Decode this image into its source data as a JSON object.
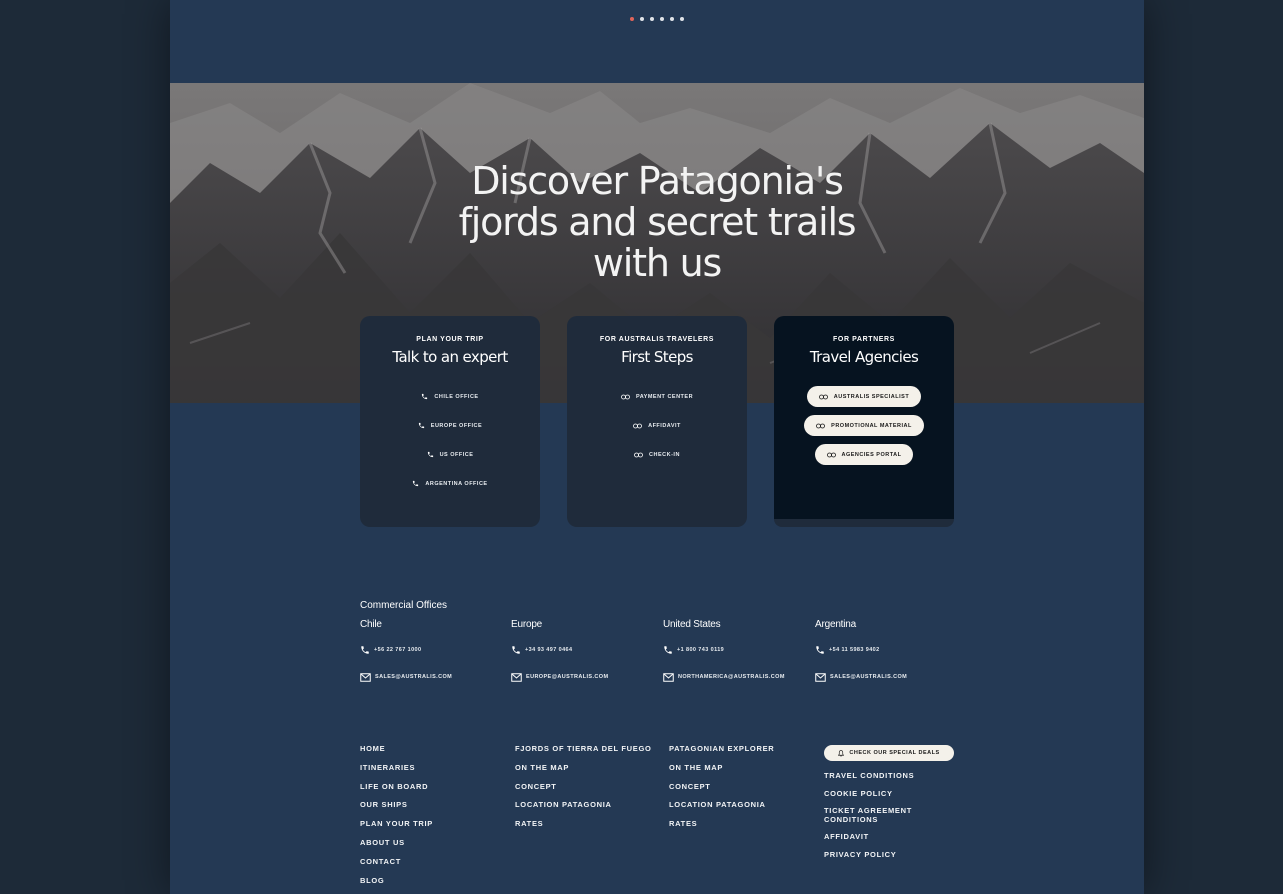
{
  "slider": {
    "dot_count": 6,
    "active_index": 0
  },
  "hero": {
    "title_lines": [
      "Discover Patagonia's",
      "fjords and secret trails",
      "with us"
    ]
  },
  "cards": [
    {
      "eyebrow": "PLAN YOUR TRIP",
      "title": "Talk to an expert",
      "links": [
        {
          "icon": "phone-icon",
          "label": "CHILE OFFICE"
        },
        {
          "icon": "phone-icon",
          "label": "EUROPE OFFICE"
        },
        {
          "icon": "phone-icon",
          "label": "US OFFICE"
        },
        {
          "icon": "phone-icon",
          "label": "ARGENTINA OFFICE"
        }
      ]
    },
    {
      "eyebrow": "FOR AUSTRALIS TRAVELERS",
      "title": "First Steps",
      "links": [
        {
          "icon": "link-icon",
          "label": "PAYMENT CENTER"
        },
        {
          "icon": "link-icon",
          "label": "AFFIDAVIT"
        },
        {
          "icon": "link-icon",
          "label": "CHECK-IN"
        }
      ]
    },
    {
      "eyebrow": "FOR PARTNERS",
      "title": "Travel Agencies",
      "links": [
        {
          "icon": "link-icon",
          "label": "AUSTRALIS SPECIALIST"
        },
        {
          "icon": "link-icon",
          "label": "PROMOTIONAL MATERIAL"
        },
        {
          "icon": "link-icon",
          "label": "AGENCIES PORTAL"
        }
      ]
    }
  ],
  "offices": {
    "title": "Commercial Offices",
    "items": [
      {
        "name": "Chile",
        "phone": "+56 22 767 1000",
        "email": "SALES@AUSTRALIS.COM"
      },
      {
        "name": "Europe",
        "phone": "+34 93 497 0464",
        "email": "EUROPE@AUSTRALIS.COM"
      },
      {
        "name": "United States",
        "phone": "+1 800 743 0119",
        "email": "NORTHAMERICA@AUSTRALIS.COM"
      },
      {
        "name": "Argentina",
        "phone": "+54 11 5983 9402",
        "email": "SALES@AUSTRALIS.COM"
      }
    ]
  },
  "footer": {
    "col1": [
      "HOME",
      "ITINERARIES",
      "LIFE ON BOARD",
      "OUR SHIPS",
      "PLAN YOUR TRIP",
      "ABOUT US",
      "CONTACT",
      "BLOG"
    ],
    "col2": [
      "FJORDS OF TIERRA DEL FUEGO",
      "ON THE MAP",
      "CONCEPT",
      "LOCATION PATAGONIA",
      "RATES"
    ],
    "col3": [
      "PATAGONIAN EXPLORER",
      "ON THE MAP",
      "CONCEPT",
      "LOCATION PATAGONIA",
      "RATES"
    ],
    "deals_label": "CHECK OUR SPECIAL DEALS",
    "col4": [
      "TRAVEL CONDITIONS",
      "COOKIE POLICY",
      "TICKET AGREEMENT CONDITIONS",
      "AFFIDAVIT",
      "PRIVACY POLICY"
    ]
  },
  "colors": {
    "page_bg": "#243954",
    "outer_bg": "#1d2a38",
    "card_bg": "#1f2b3b",
    "partner_card_bg": "#061320",
    "pill_bg": "#f4f1ea",
    "active_dot": "#e0645a"
  }
}
